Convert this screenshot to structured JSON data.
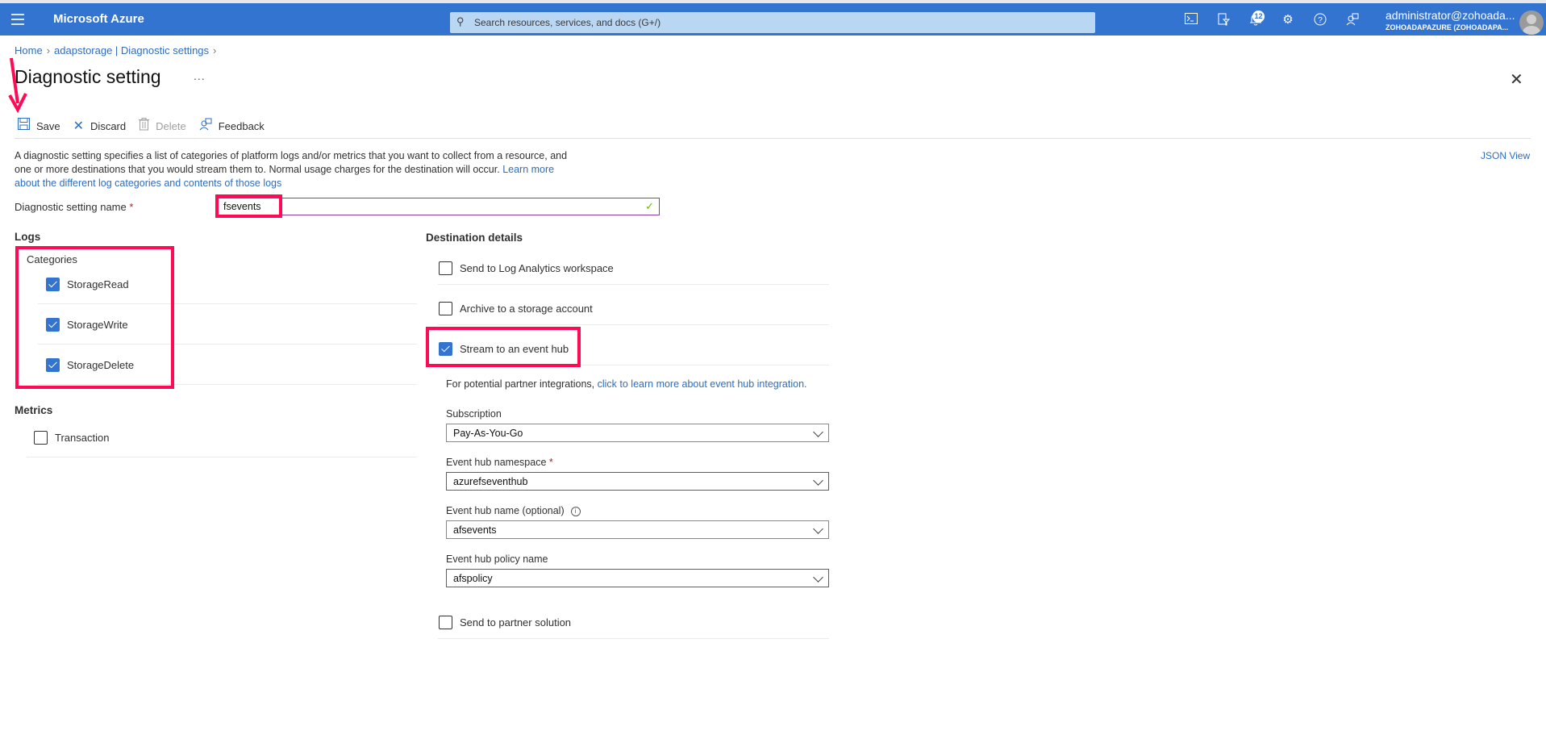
{
  "header": {
    "brand": "Microsoft Azure",
    "search_placeholder": "Search resources, services, and docs (G+/)",
    "notifications_count": "12",
    "user_name": "administrator@zohoada...",
    "user_tenant": "ZOHOADAPAZURE (ZOHOADAPA...",
    "icons": [
      "cloud-shell-icon",
      "directory-filter-icon",
      "notifications-icon",
      "settings-icon",
      "help-icon",
      "feedback-icon"
    ]
  },
  "breadcrumb": {
    "items": [
      "Home",
      "adapstorage | Diagnostic settings"
    ]
  },
  "page": {
    "title": "Diagnostic setting",
    "more": "...",
    "json_view": "JSON View"
  },
  "toolbar": {
    "save": "Save",
    "discard": "Discard",
    "delete": "Delete",
    "feedback": "Feedback"
  },
  "description": {
    "text": "A diagnostic setting specifies a list of categories of platform logs and/or metrics that you want to collect from a resource, and one or more destinations that you would stream them to. Normal usage charges for the destination will occur.",
    "link": "Learn more about the different log categories and contents of those logs"
  },
  "name_field": {
    "label": "Diagnostic setting name",
    "required": "*",
    "value": "fsevents"
  },
  "logs": {
    "heading": "Logs",
    "categories_label": "Categories",
    "categories": [
      {
        "label": "StorageRead",
        "checked": true
      },
      {
        "label": "StorageWrite",
        "checked": true
      },
      {
        "label": "StorageDelete",
        "checked": true
      }
    ]
  },
  "metrics": {
    "heading": "Metrics",
    "items": [
      {
        "label": "Transaction",
        "checked": false
      }
    ]
  },
  "destination": {
    "heading": "Destination details",
    "options": [
      {
        "label": "Send to Log Analytics workspace",
        "checked": false
      },
      {
        "label": "Archive to a storage account",
        "checked": false
      },
      {
        "label": "Stream to an event hub",
        "checked": true
      }
    ],
    "partner_text": "For potential partner integrations,",
    "partner_link": "click to learn more about event hub integration.",
    "subscription_label": "Subscription",
    "subscription_value": "Pay-As-You-Go",
    "namespace_label": "Event hub namespace",
    "namespace_required": "*",
    "namespace_value": "azurefseventhub",
    "hub_name_label": "Event hub name (optional)",
    "hub_name_value": "afsevents",
    "policy_label": "Event hub policy name",
    "policy_value": "afspolicy",
    "partner_solution": {
      "label": "Send to partner solution",
      "checked": false
    }
  },
  "colors": {
    "azure_blue": "#3374d1",
    "highlight": "#ff0a54",
    "link": "#2f6dbf",
    "valid_border": "#8a3ca8"
  }
}
